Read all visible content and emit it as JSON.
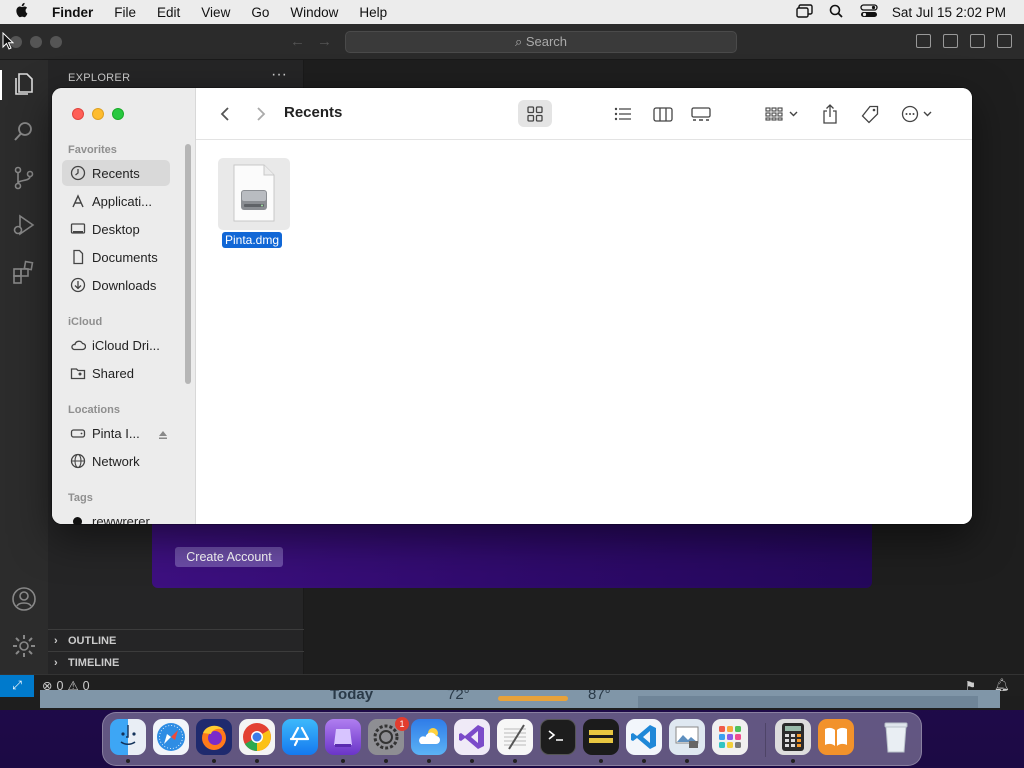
{
  "menubar": {
    "app": "Finder",
    "items": [
      "File",
      "Edit",
      "View",
      "Go",
      "Window",
      "Help"
    ],
    "datetime": "Sat Jul 15  2:02 PM"
  },
  "vscode": {
    "search_label": "Search",
    "sidebar_title": "EXPLORER",
    "sidebar_more": "···",
    "outline": "OUTLINE",
    "timeline": "TIMELINE",
    "status": {
      "errors": "0",
      "warnings": "0"
    },
    "webview": {
      "create_account": "Create Account"
    }
  },
  "finder": {
    "title": "Recents",
    "groups": {
      "favorites": "Favorites",
      "icloud": "iCloud",
      "locations": "Locations",
      "tags": "Tags"
    },
    "favorites": [
      {
        "label": "Recents",
        "icon": "clock-icon",
        "selected": true
      },
      {
        "label": "Applicati...",
        "icon": "applications-icon"
      },
      {
        "label": "Desktop",
        "icon": "desktop-icon"
      },
      {
        "label": "Documents",
        "icon": "document-icon"
      },
      {
        "label": "Downloads",
        "icon": "download-icon"
      }
    ],
    "icloud": [
      {
        "label": "iCloud Dri...",
        "icon": "cloud-icon"
      },
      {
        "label": "Shared",
        "icon": "shared-folder-icon"
      }
    ],
    "locations": [
      {
        "label": "Pinta I...",
        "icon": "disk-icon"
      },
      {
        "label": "Network",
        "icon": "globe-icon"
      }
    ],
    "tags": [
      {
        "label": "rewwrerer",
        "color": "#111111"
      }
    ],
    "files": [
      {
        "name": "Pinta.dmg",
        "icon": "disk-image-icon",
        "selected": true
      }
    ]
  },
  "widgets": {
    "today": "Today",
    "temp_low": "72°",
    "temp_high": "87°"
  },
  "dock": {
    "apps": [
      "Finder",
      "Safari",
      "Firefox",
      "Chrome",
      "App Store",
      "Podcasts Purple",
      "System Settings",
      "Weather",
      "Visual Studio",
      "TextEdit",
      "Terminal",
      "Console",
      "VS Code",
      "Preview",
      "Launchpad",
      "Calculator",
      "Books",
      "Trash"
    ],
    "settings_badge": "1"
  },
  "colors": {
    "accent": "#1167d6",
    "vscode_bg": "#1e1e1e",
    "statusbar_remote": "#007acc"
  }
}
